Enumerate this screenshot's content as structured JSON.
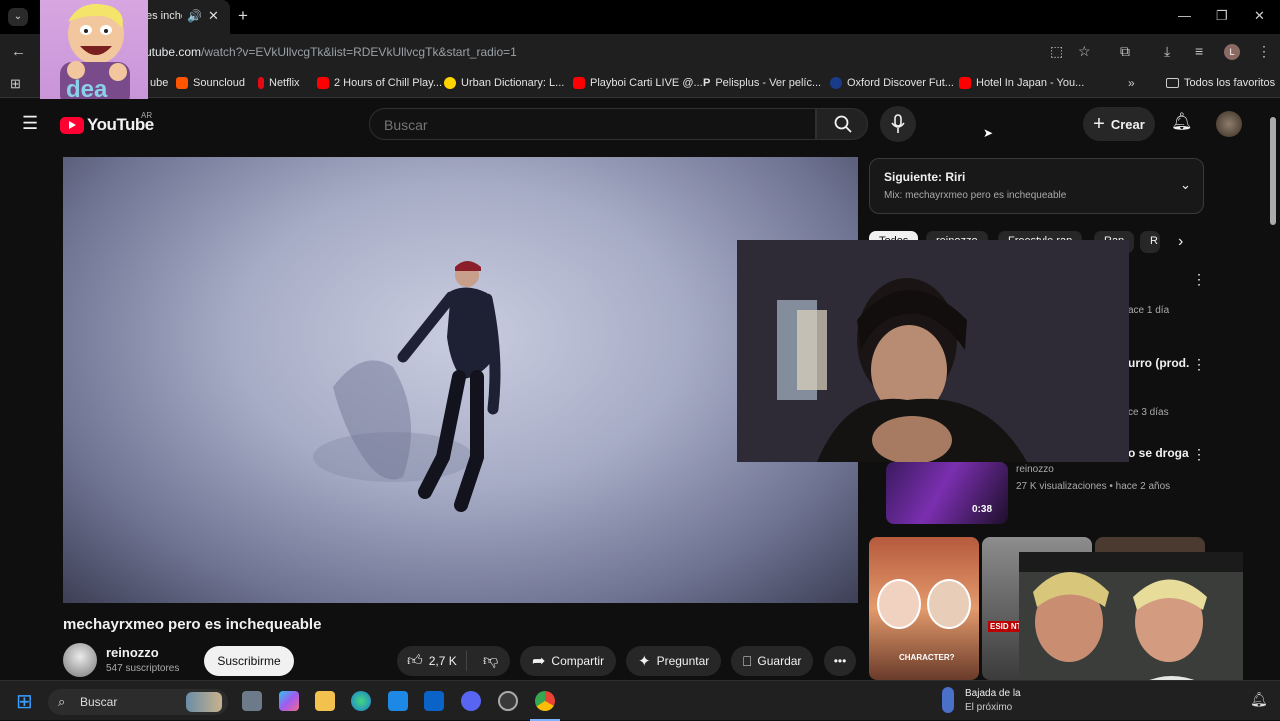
{
  "browser": {
    "tab_title": "es inche",
    "url_domain": "utube.com",
    "url_path": "/watch?v=EVkUllvcgTk&list=RDEVkUllvcgTk&start_radio=1",
    "bookmarks": [
      {
        "label": "ube",
        "color": "#ff0000"
      },
      {
        "label": "Souncloud",
        "color": "#ff5500"
      },
      {
        "label": "Netflix",
        "color": "#e50914"
      },
      {
        "label": "2 Hours of Chill Play...",
        "color": "#ff0000"
      },
      {
        "label": "Urban Dictionary: L...",
        "color": "#ffd400"
      },
      {
        "label": "Playboi Carti LIVE @...",
        "color": "#ff0000"
      },
      {
        "label": "Pelisplus - Ver pelíc...",
        "color": "#ffffff"
      },
      {
        "label": "Oxford Discover Fut...",
        "color": "#1a3a8a"
      },
      {
        "label": "Hotel In Japan - You...",
        "color": "#ff0000"
      }
    ],
    "all_bookmarks": "Todos los favoritos"
  },
  "sticker_text": "dea",
  "youtube": {
    "logo": "YouTube",
    "region": "AR",
    "search_placeholder": "Buscar",
    "create_label": "Crear",
    "video": {
      "title": "mechayrxmeo pero es inchequeable",
      "channel": "reinozzo",
      "subscribers": "547 suscriptores",
      "subscribe_label": "Suscribirme",
      "likes": "2,7 K",
      "share_label": "Compartir",
      "ask_label": "Preguntar",
      "save_label": "Guardar"
    },
    "next": {
      "title": "Siguiente: Riri",
      "subtitle": "Mix: mechayrxmeo pero es inchequeable"
    },
    "chips": [
      "Todos",
      "reinozzo",
      "Freestyle rap",
      "Rap",
      "R"
    ],
    "related": [
      {
        "title": "",
        "meta": "ace 1 día"
      },
      {
        "title": "urro (prod.",
        "meta": "ce 3 días"
      },
      {
        "title": "o se droga",
        "channel": "reinozzo",
        "meta": "27 K visualizaciones • hace 2 años",
        "duration": "0:38"
      }
    ],
    "shorts": [
      {
        "label": "CHARACTER?",
        "color": "#c0684a"
      },
      {
        "label": "ESID NT",
        "color": "#555"
      }
    ]
  },
  "taskbar": {
    "search_label": "Buscar",
    "notification_title": "Bajada de la",
    "notification_sub": "El próximo"
  }
}
